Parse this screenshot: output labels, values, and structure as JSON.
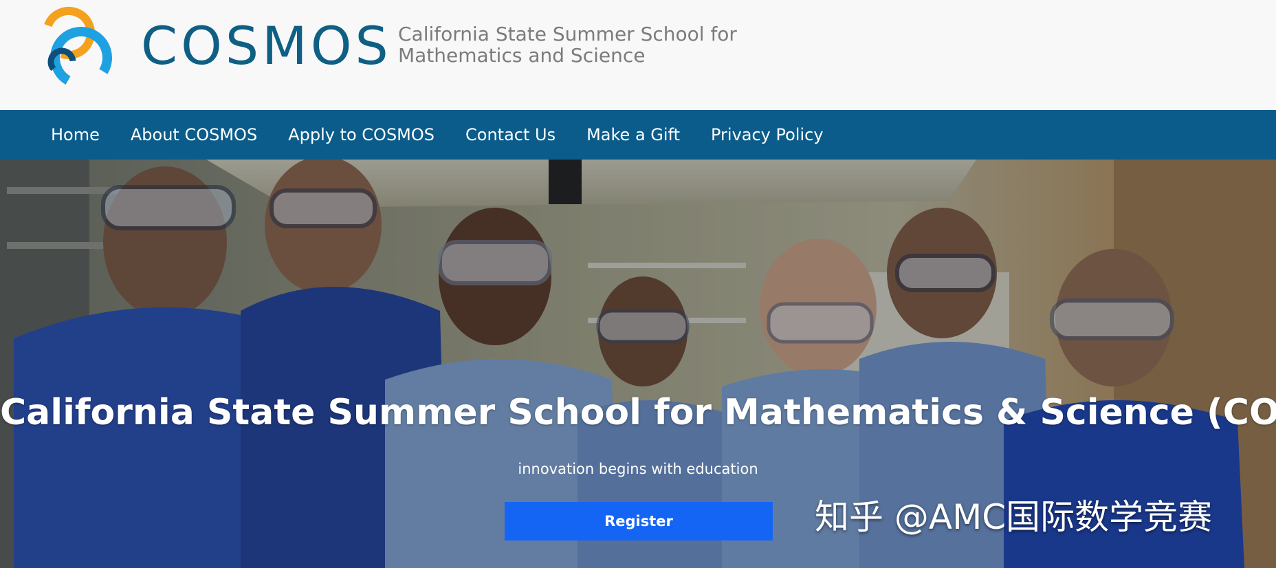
{
  "header": {
    "logo_text": "COSMOS",
    "tagline_line1": "California State Summer School for",
    "tagline_line2": "Mathematics and Science",
    "colors": {
      "brand": "#0f5f85",
      "logo_orange": "#f4a11d",
      "logo_blue": "#1ea1e0",
      "logo_navy": "#0d4f7a"
    }
  },
  "nav": {
    "items": [
      {
        "label": "Home"
      },
      {
        "label": "About COSMOS"
      },
      {
        "label": "Apply to COSMOS"
      },
      {
        "label": "Contact Us"
      },
      {
        "label": "Make a Gift"
      },
      {
        "label": "Privacy Policy"
      }
    ],
    "colors": {
      "background": "#0b5c8a"
    }
  },
  "hero": {
    "title": "California State Summer School for Mathematics & Science (COSMOS)",
    "subtitle": "innovation begins with education",
    "register_label": "Register",
    "watermark": "知乎 @AMC国际数学竞赛",
    "colors": {
      "button": "#1565f5"
    }
  }
}
